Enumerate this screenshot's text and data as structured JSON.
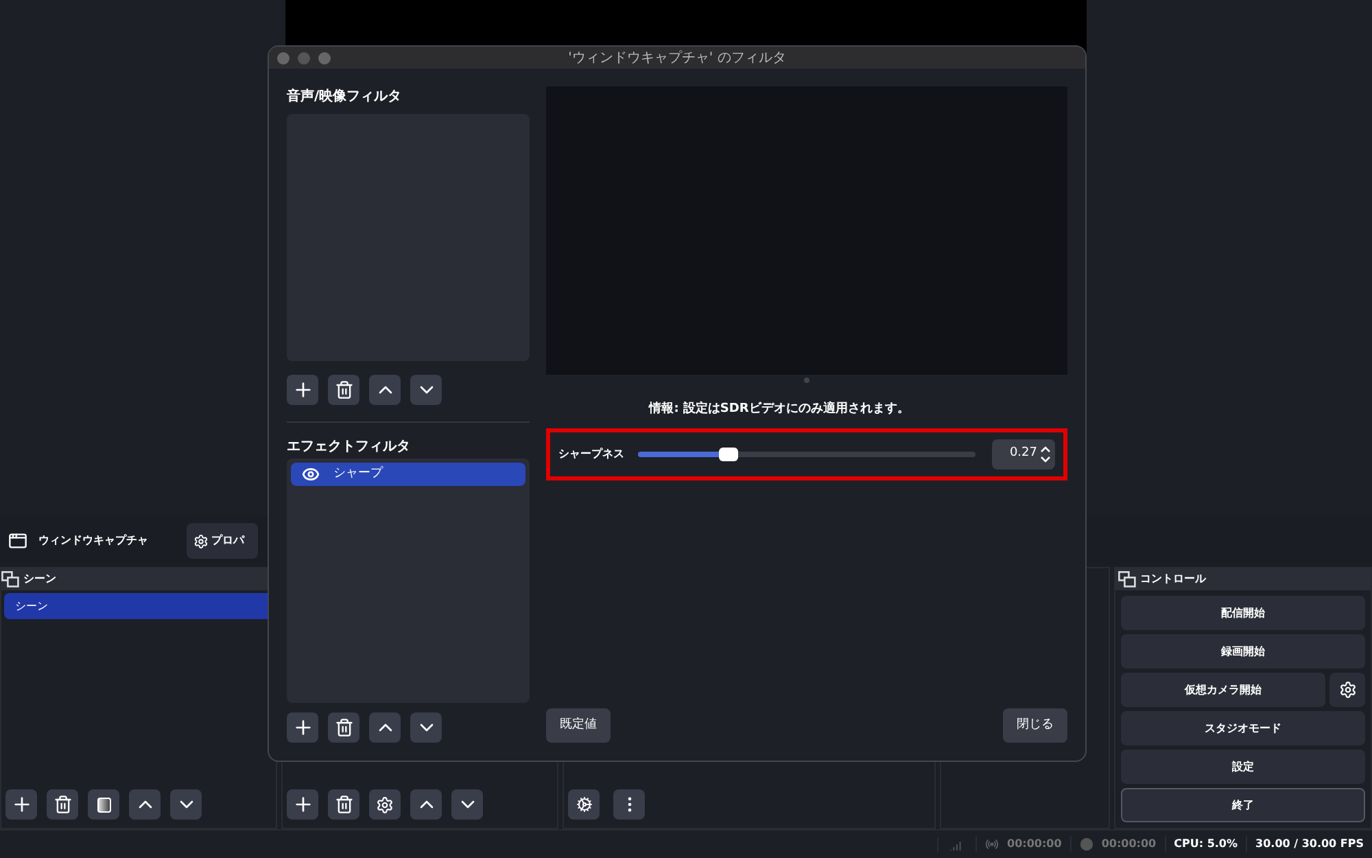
{
  "source_bar": {
    "source_name": "ウィンドウキャプチャ",
    "properties_button": "プロパ"
  },
  "scenes": {
    "title": "シーン",
    "items": [
      {
        "label": "シーン",
        "selected": true
      }
    ]
  },
  "controls": {
    "title": "コントロール",
    "buttons": [
      {
        "label": "配信開始",
        "kind": "plain"
      },
      {
        "label": "録画開始",
        "kind": "plain"
      },
      {
        "label": "仮想カメラ開始",
        "kind": "with_settings"
      },
      {
        "label": "スタジオモード",
        "kind": "plain"
      },
      {
        "label": "設定",
        "kind": "plain"
      },
      {
        "label": "終了",
        "kind": "plain"
      }
    ]
  },
  "status_bar": {
    "stream_time": "00:00:00",
    "record_time": "00:00:00",
    "cpu": "CPU: 5.0%",
    "fps": "30.00 / 30.00 FPS"
  },
  "dialog": {
    "title": "'ウィンドウキャプチャ' のフィルタ",
    "av_filters": {
      "title": "音声/映像フィルタ"
    },
    "effect_filters": {
      "title": "エフェクトフィルタ",
      "items": [
        {
          "label": "シャープ",
          "selected": true,
          "visible": true
        }
      ]
    },
    "info": "情報: 設定はSDRビデオにのみ適用されます。",
    "settings": [
      {
        "label": "シャープネス",
        "level": 0.27,
        "value": "0.27",
        "highlighted": true
      }
    ],
    "buttons": {
      "defaults": "既定値",
      "close": "閉じる"
    }
  }
}
